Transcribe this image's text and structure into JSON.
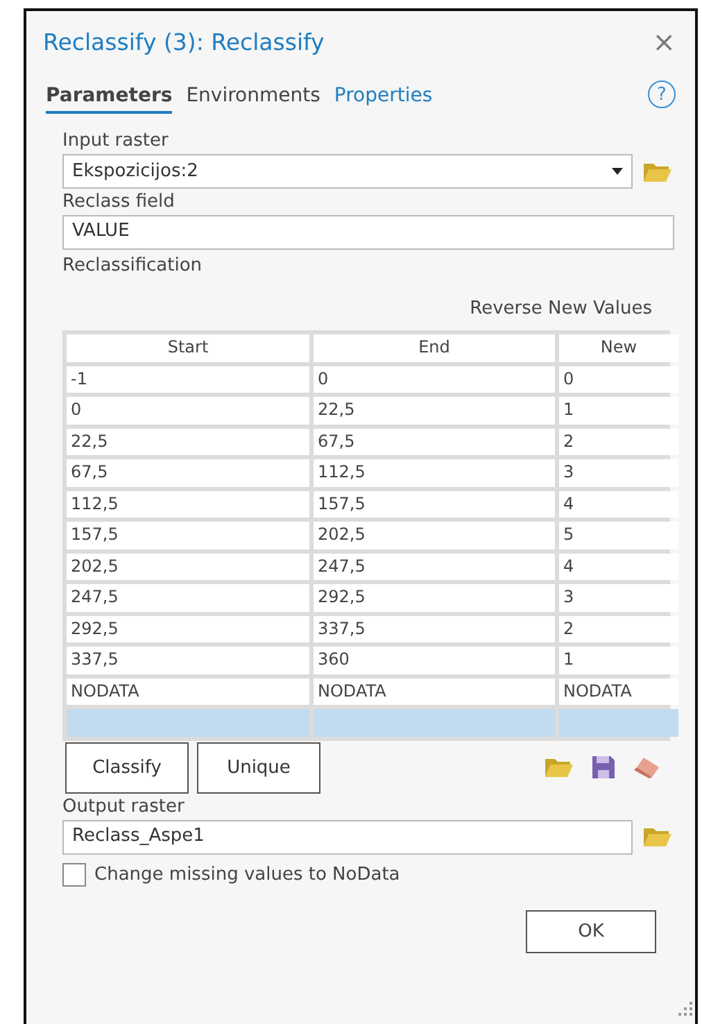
{
  "window": {
    "title": "Reclassify (3): Reclassify",
    "close": "×"
  },
  "tabs": [
    {
      "label": "Parameters",
      "selected": true,
      "kind": "plain"
    },
    {
      "label": "Environments",
      "selected": false,
      "kind": "plain"
    },
    {
      "label": "Properties",
      "selected": false,
      "kind": "link"
    }
  ],
  "help": "?",
  "input_raster": {
    "label": "Input raster",
    "value": "Ekspozicijos:2"
  },
  "reclass_field": {
    "label": "Reclass field",
    "value": "VALUE"
  },
  "reclassification": {
    "label": "Reclassification",
    "reverse_button": "Reverse New Values",
    "table": {
      "columns": [
        "Start",
        "End",
        "New"
      ],
      "rows": [
        [
          "-1",
          "0",
          "0"
        ],
        [
          "0",
          "22,5",
          "1"
        ],
        [
          "22,5",
          "67,5",
          "2"
        ],
        [
          "67,5",
          "112,5",
          "3"
        ],
        [
          "112,5",
          "157,5",
          "4"
        ],
        [
          "157,5",
          "202,5",
          "5"
        ],
        [
          "202,5",
          "247,5",
          "4"
        ],
        [
          "247,5",
          "292,5",
          "3"
        ],
        [
          "292,5",
          "337,5",
          "2"
        ],
        [
          "337,5",
          "360",
          "1"
        ],
        [
          "NODATA",
          "NODATA",
          "NODATA"
        ]
      ]
    },
    "buttons": [
      "Classify",
      "Unique"
    ]
  },
  "output_raster": {
    "label": "Output raster",
    "value": "Reclass_Aspe1"
  },
  "missing_to_nodata": {
    "label": "Change missing values to NoData",
    "checked": false
  },
  "ok_button": "OK"
}
